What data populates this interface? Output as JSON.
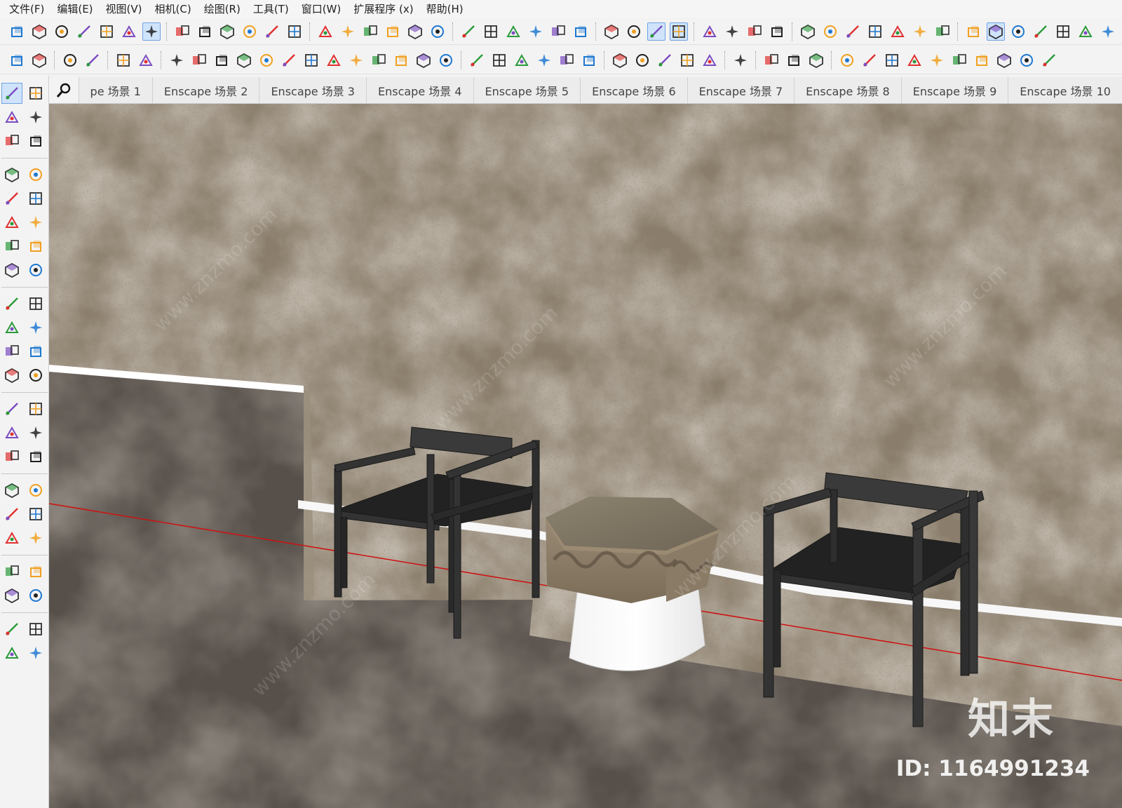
{
  "menu": [
    "文件(F)",
    "编辑(E)",
    "视图(V)",
    "相机(C)",
    "绘图(R)",
    "工具(T)",
    "窗口(W)",
    "扩展程序 (x)",
    "帮助(H)"
  ],
  "scene_tabs": [
    "pe 场景 1",
    "Enscape 场景 2",
    "Enscape 场景 3",
    "Enscape 场景 4",
    "Enscape 场景 5",
    "Enscape 场景 6",
    "Enscape 场景 7",
    "Enscape 场景 8",
    "Enscape 场景 9",
    "Enscape 场景 10"
  ],
  "toolbar_row1_icons": [
    "iso-view-icon",
    "top-view-icon",
    "front-view-icon",
    "right-view-icon",
    "back-view-icon",
    "left-view-icon",
    "bottom-view-icon",
    "xray-icon",
    "wireframe-icon",
    "hidden-line-icon",
    "shaded-icon",
    "textured-icon",
    "monochrome-icon",
    "component-icon",
    "group-icon",
    "house-icon",
    "door-icon",
    "window-icon",
    "stair-icon",
    "wall-icon",
    "layer-icon",
    "layers-icon",
    "copy-icon",
    "paste-icon",
    "stack-icon",
    "orbit-icon",
    "globe-icon",
    "section-icon",
    "section-fill-icon",
    "camera-icon",
    "scene-a-icon",
    "scene-b-icon",
    "scene-c-icon",
    "mesh-icon",
    "grid-icon",
    "axis-icon",
    "terrain-icon",
    "sandbox-icon",
    "stamp-icon",
    "drape-icon",
    "gear-check-icon",
    "swap-icon",
    "export-icon",
    "add-icon",
    "shield-icon",
    "building-icon",
    "checker-icon",
    "cloud-icon"
  ],
  "toolbar_row2_icons": [
    "open-folder-icon",
    "save-icon",
    "copy-prop-icon",
    "paste-prop-icon",
    "select-window-icon",
    "flip-icon",
    "line-tool-icon",
    "rectangle-icon",
    "push-icon",
    "circle-net-icon",
    "curve-icon",
    "polyline-icon",
    "slash-icon",
    "dot-grid-icon",
    "knife-icon",
    "slab-icon",
    "basket-icon",
    "stack-layers-icon",
    "cube-red-icon",
    "dropdown-icon",
    "book-icon",
    "download-icon",
    "box-icon",
    "filmstrip-icon",
    "panel-icon",
    "arc-icon",
    "no-icon",
    "bucket-icon",
    "dropper-icon",
    "grid-plus-icon",
    "page-icon",
    "stairs-green-icon",
    "pick-icon",
    "paint-icon",
    "filter-icon",
    "swirl-icon",
    "move-icon",
    "rotate-icon",
    "align-icon",
    "mirror-icon",
    "layout-icon",
    "array-icon",
    "array-b-icon",
    "expand-icon"
  ],
  "palette_icons": [
    "select-arrow-icon",
    "lasso-icon",
    "paint-bucket-icon",
    "eraser-icon",
    "component-icon",
    "tag-icon",
    "pencil-icon",
    "freehand-icon",
    "rectangle-icon",
    "rotated-rect-icon",
    "circle-icon",
    "polygon-icon",
    "arc-icon",
    "arc-2-icon",
    "arc-3-icon",
    "pie-icon",
    "move-icon",
    "push-pull-icon",
    "rotate-icon",
    "follow-me-icon",
    "scale-icon",
    "offset-icon",
    "flip-icon",
    "mirror-icon",
    "tape-measure-icon",
    "dimension-icon",
    "protractor-icon",
    "text-icon",
    "axes-icon",
    "3d-text-icon",
    "section-plane-icon",
    "pan-icon",
    "zoom-icon",
    "zoom-window-icon",
    "zoom-extents-icon",
    "previous-view-icon",
    "position-camera-icon",
    "walk-icon",
    "look-around-icon",
    "sound-icon",
    "sandbox-a-icon",
    "sandbox-b-icon",
    "sandbox-c-icon",
    "sandbox-d-icon"
  ],
  "watermark": {
    "logo": "知末",
    "id_text": "ID: 1164991234",
    "diagonal": "www.znzmo.com"
  },
  "colors": {
    "wall": "#8a7d6b",
    "floor": "#57504a",
    "chair": "#2c2c2c",
    "axis_red": "#d01010",
    "accent_blue": "#1e78d0",
    "accent_red": "#e03030"
  }
}
